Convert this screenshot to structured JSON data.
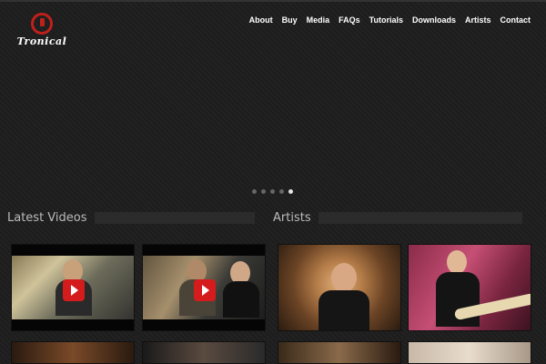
{
  "brand": {
    "name": "Tronical"
  },
  "nav": {
    "items": [
      "About",
      "Buy",
      "Media",
      "FAQs",
      "Tutorials",
      "Downloads",
      "Artists",
      "Contact"
    ]
  },
  "slider": {
    "slide_count": 5,
    "active_index": 4
  },
  "sections": {
    "videos_title": "Latest Videos",
    "artists_title": "Artists"
  },
  "icons": {
    "play": "play-icon",
    "logo": "tronical-logo-icon"
  },
  "colors": {
    "accent": "#d41c1c",
    "background": "#1e1e1e",
    "nav_text": "#ffffff"
  }
}
